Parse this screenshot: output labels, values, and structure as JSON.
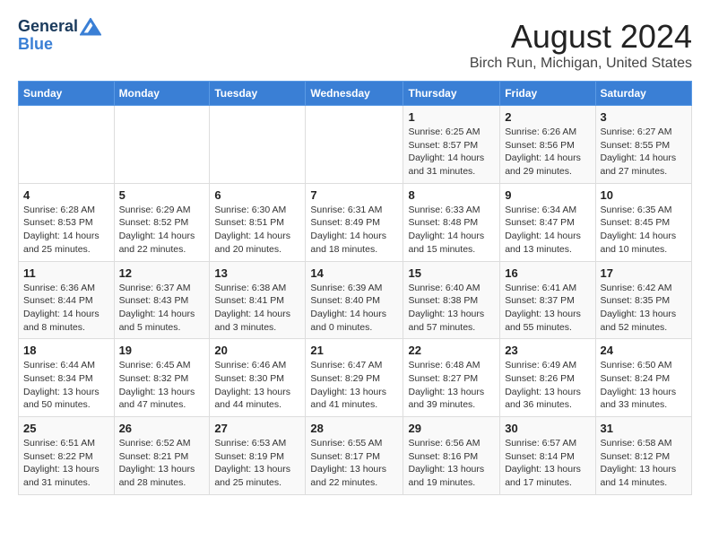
{
  "header": {
    "logo_line1": "General",
    "logo_line2": "Blue",
    "main_title": "August 2024",
    "subtitle": "Birch Run, Michigan, United States"
  },
  "calendar": {
    "days_of_week": [
      "Sunday",
      "Monday",
      "Tuesday",
      "Wednesday",
      "Thursday",
      "Friday",
      "Saturday"
    ],
    "weeks": [
      [
        {
          "day": "",
          "info": ""
        },
        {
          "day": "",
          "info": ""
        },
        {
          "day": "",
          "info": ""
        },
        {
          "day": "",
          "info": ""
        },
        {
          "day": "1",
          "info": "Sunrise: 6:25 AM\nSunset: 8:57 PM\nDaylight: 14 hours and 31 minutes."
        },
        {
          "day": "2",
          "info": "Sunrise: 6:26 AM\nSunset: 8:56 PM\nDaylight: 14 hours and 29 minutes."
        },
        {
          "day": "3",
          "info": "Sunrise: 6:27 AM\nSunset: 8:55 PM\nDaylight: 14 hours and 27 minutes."
        }
      ],
      [
        {
          "day": "4",
          "info": "Sunrise: 6:28 AM\nSunset: 8:53 PM\nDaylight: 14 hours and 25 minutes."
        },
        {
          "day": "5",
          "info": "Sunrise: 6:29 AM\nSunset: 8:52 PM\nDaylight: 14 hours and 22 minutes."
        },
        {
          "day": "6",
          "info": "Sunrise: 6:30 AM\nSunset: 8:51 PM\nDaylight: 14 hours and 20 minutes."
        },
        {
          "day": "7",
          "info": "Sunrise: 6:31 AM\nSunset: 8:49 PM\nDaylight: 14 hours and 18 minutes."
        },
        {
          "day": "8",
          "info": "Sunrise: 6:33 AM\nSunset: 8:48 PM\nDaylight: 14 hours and 15 minutes."
        },
        {
          "day": "9",
          "info": "Sunrise: 6:34 AM\nSunset: 8:47 PM\nDaylight: 14 hours and 13 minutes."
        },
        {
          "day": "10",
          "info": "Sunrise: 6:35 AM\nSunset: 8:45 PM\nDaylight: 14 hours and 10 minutes."
        }
      ],
      [
        {
          "day": "11",
          "info": "Sunrise: 6:36 AM\nSunset: 8:44 PM\nDaylight: 14 hours and 8 minutes."
        },
        {
          "day": "12",
          "info": "Sunrise: 6:37 AM\nSunset: 8:43 PM\nDaylight: 14 hours and 5 minutes."
        },
        {
          "day": "13",
          "info": "Sunrise: 6:38 AM\nSunset: 8:41 PM\nDaylight: 14 hours and 3 minutes."
        },
        {
          "day": "14",
          "info": "Sunrise: 6:39 AM\nSunset: 8:40 PM\nDaylight: 14 hours and 0 minutes."
        },
        {
          "day": "15",
          "info": "Sunrise: 6:40 AM\nSunset: 8:38 PM\nDaylight: 13 hours and 57 minutes."
        },
        {
          "day": "16",
          "info": "Sunrise: 6:41 AM\nSunset: 8:37 PM\nDaylight: 13 hours and 55 minutes."
        },
        {
          "day": "17",
          "info": "Sunrise: 6:42 AM\nSunset: 8:35 PM\nDaylight: 13 hours and 52 minutes."
        }
      ],
      [
        {
          "day": "18",
          "info": "Sunrise: 6:44 AM\nSunset: 8:34 PM\nDaylight: 13 hours and 50 minutes."
        },
        {
          "day": "19",
          "info": "Sunrise: 6:45 AM\nSunset: 8:32 PM\nDaylight: 13 hours and 47 minutes."
        },
        {
          "day": "20",
          "info": "Sunrise: 6:46 AM\nSunset: 8:30 PM\nDaylight: 13 hours and 44 minutes."
        },
        {
          "day": "21",
          "info": "Sunrise: 6:47 AM\nSunset: 8:29 PM\nDaylight: 13 hours and 41 minutes."
        },
        {
          "day": "22",
          "info": "Sunrise: 6:48 AM\nSunset: 8:27 PM\nDaylight: 13 hours and 39 minutes."
        },
        {
          "day": "23",
          "info": "Sunrise: 6:49 AM\nSunset: 8:26 PM\nDaylight: 13 hours and 36 minutes."
        },
        {
          "day": "24",
          "info": "Sunrise: 6:50 AM\nSunset: 8:24 PM\nDaylight: 13 hours and 33 minutes."
        }
      ],
      [
        {
          "day": "25",
          "info": "Sunrise: 6:51 AM\nSunset: 8:22 PM\nDaylight: 13 hours and 31 minutes."
        },
        {
          "day": "26",
          "info": "Sunrise: 6:52 AM\nSunset: 8:21 PM\nDaylight: 13 hours and 28 minutes."
        },
        {
          "day": "27",
          "info": "Sunrise: 6:53 AM\nSunset: 8:19 PM\nDaylight: 13 hours and 25 minutes."
        },
        {
          "day": "28",
          "info": "Sunrise: 6:55 AM\nSunset: 8:17 PM\nDaylight: 13 hours and 22 minutes."
        },
        {
          "day": "29",
          "info": "Sunrise: 6:56 AM\nSunset: 8:16 PM\nDaylight: 13 hours and 19 minutes."
        },
        {
          "day": "30",
          "info": "Sunrise: 6:57 AM\nSunset: 8:14 PM\nDaylight: 13 hours and 17 minutes."
        },
        {
          "day": "31",
          "info": "Sunrise: 6:58 AM\nSunset: 8:12 PM\nDaylight: 13 hours and 14 minutes."
        }
      ]
    ]
  }
}
